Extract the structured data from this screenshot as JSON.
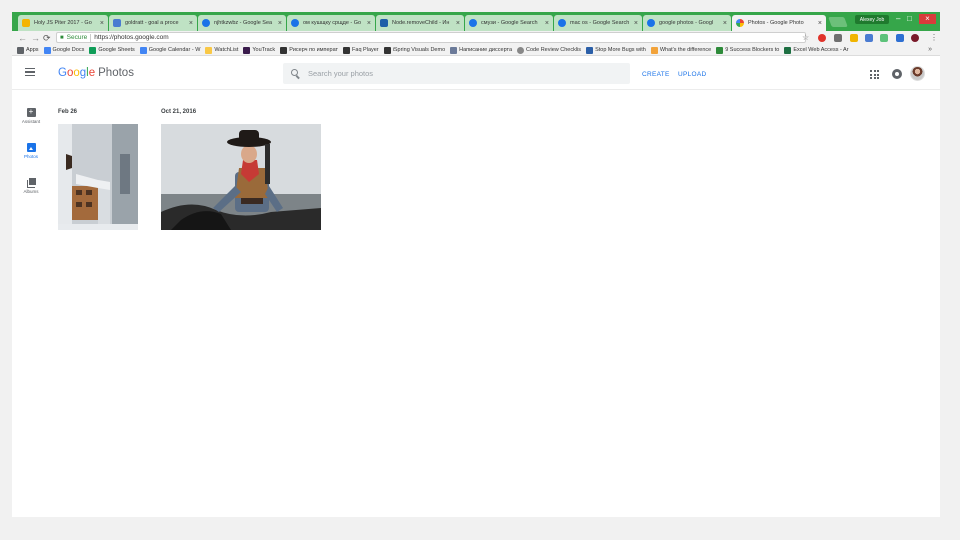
{
  "browser": {
    "tabs": [
      {
        "title": "Holy JS Piter 2017 - Go",
        "color": "#f4b400"
      },
      {
        "title": "goldratt - goal a proce",
        "color": "#4a7bd1"
      },
      {
        "title": "njhtkzwbz - Google Sea",
        "color": "#1a73e8"
      },
      {
        "title": "ом кушщку срщде - Go",
        "color": "#1a73e8"
      },
      {
        "title": "Node.removeChild - Ин",
        "color": "#1f5fa8"
      },
      {
        "title": "смузи - Google Search",
        "color": "#1a73e8"
      },
      {
        "title": "mac os - Google Search",
        "color": "#1a73e8"
      },
      {
        "title": "google photos - Googl",
        "color": "#1a73e8"
      },
      {
        "title": "Photos - Google Photo",
        "color": "#fbbc05"
      }
    ],
    "active_tab_index": 8,
    "profile_name": "Alexey Job",
    "address": {
      "secure_label": "Secure",
      "url": "https://photos.google.com"
    },
    "bookmarks": [
      {
        "label": "Apps",
        "color": "#5f6368"
      },
      {
        "label": "Google Docs",
        "color": "#4285f4"
      },
      {
        "label": "Google Sheets",
        "color": "#0f9d58"
      },
      {
        "label": "Google Calendar - W",
        "color": "#4285f4"
      },
      {
        "label": "WatchList",
        "color": "#f9c846"
      },
      {
        "label": "YouTrack",
        "color": "#3a1c4c"
      },
      {
        "label": "Рисерч по императ",
        "color": "#333333"
      },
      {
        "label": "Faq Player",
        "color": "#333333"
      },
      {
        "label": "iSpring Visuals Demo",
        "color": "#333333"
      },
      {
        "label": "Написание диссерта",
        "color": "#6b7a99"
      },
      {
        "label": "Code Review Checklis",
        "color": "#888888"
      },
      {
        "label": "Stop More Bugs with",
        "color": "#2b5fa8"
      },
      {
        "label": "What's the difference",
        "color": "#f2a33a"
      },
      {
        "label": "9 Success Blockers to",
        "color": "#2e8b3a"
      },
      {
        "label": "Excel Web Access - Ar",
        "color": "#1d6f42"
      }
    ]
  },
  "header": {
    "logo": {
      "google_letters": [
        {
          "ch": "G",
          "color": "#4285f4"
        },
        {
          "ch": "o",
          "color": "#ea4335"
        },
        {
          "ch": "o",
          "color": "#fbbc05"
        },
        {
          "ch": "g",
          "color": "#4285f4"
        },
        {
          "ch": "l",
          "color": "#34a853"
        },
        {
          "ch": "e",
          "color": "#ea4335"
        }
      ],
      "product": "Photos"
    },
    "search_placeholder": "Search your photos",
    "create_label": "CREATE",
    "upload_label": "UPLOAD"
  },
  "sidebar": {
    "items": [
      {
        "label": "Assistant",
        "icon": "assistant-icon"
      },
      {
        "label": "Photos",
        "icon": "photos-icon",
        "active": true
      },
      {
        "label": "Albums",
        "icon": "albums-icon"
      }
    ]
  },
  "library": {
    "groups": [
      {
        "date": "Feb 26",
        "photos": [
          "house-in-snow-rotated"
        ]
      },
      {
        "date": "Oct 21, 2016",
        "photos": [
          "cowboy-on-horse"
        ]
      }
    ]
  },
  "colors": {
    "accent": "#1a73e8",
    "tabstrip": "#36a64a"
  }
}
